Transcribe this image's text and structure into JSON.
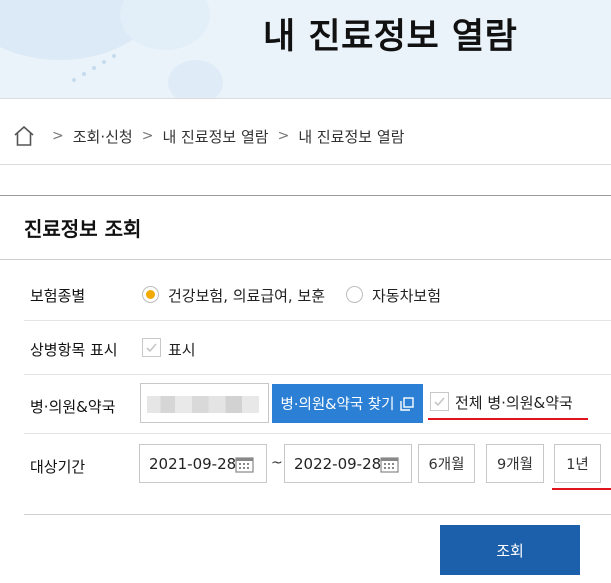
{
  "header": {
    "title": "내 진료정보 열람"
  },
  "breadcrumb": {
    "items": [
      "조회·신청",
      "내 진료정보 열람",
      "내 진료정보 열람"
    ]
  },
  "section": {
    "title": "진료정보 조회"
  },
  "insurance": {
    "label": "보험종별",
    "options": [
      {
        "label": "건강보험, 의료급여, 보훈",
        "selected": true
      },
      {
        "label": "자동차보험",
        "selected": false
      }
    ],
    "selected_color": "#f2a900"
  },
  "disease_display": {
    "label": "상병항목 표시",
    "checkbox_label": "표시",
    "checked": false
  },
  "hospital": {
    "label": "병·의원&약국",
    "find_button": "병·의원&약국 찾기",
    "all_checkbox_label": "전체 병·의원&약국",
    "all_checked": false
  },
  "period": {
    "label": "대상기간",
    "start_date": "2021-09-28",
    "end_date": "2022-09-28",
    "separator": "~",
    "buttons": [
      "6개월",
      "9개월",
      "1년"
    ]
  },
  "actions": {
    "search": "조회"
  },
  "colors": {
    "primary_button": "#2b7fd4",
    "search_button": "#1c5faa",
    "annotation": "#e0141e"
  }
}
